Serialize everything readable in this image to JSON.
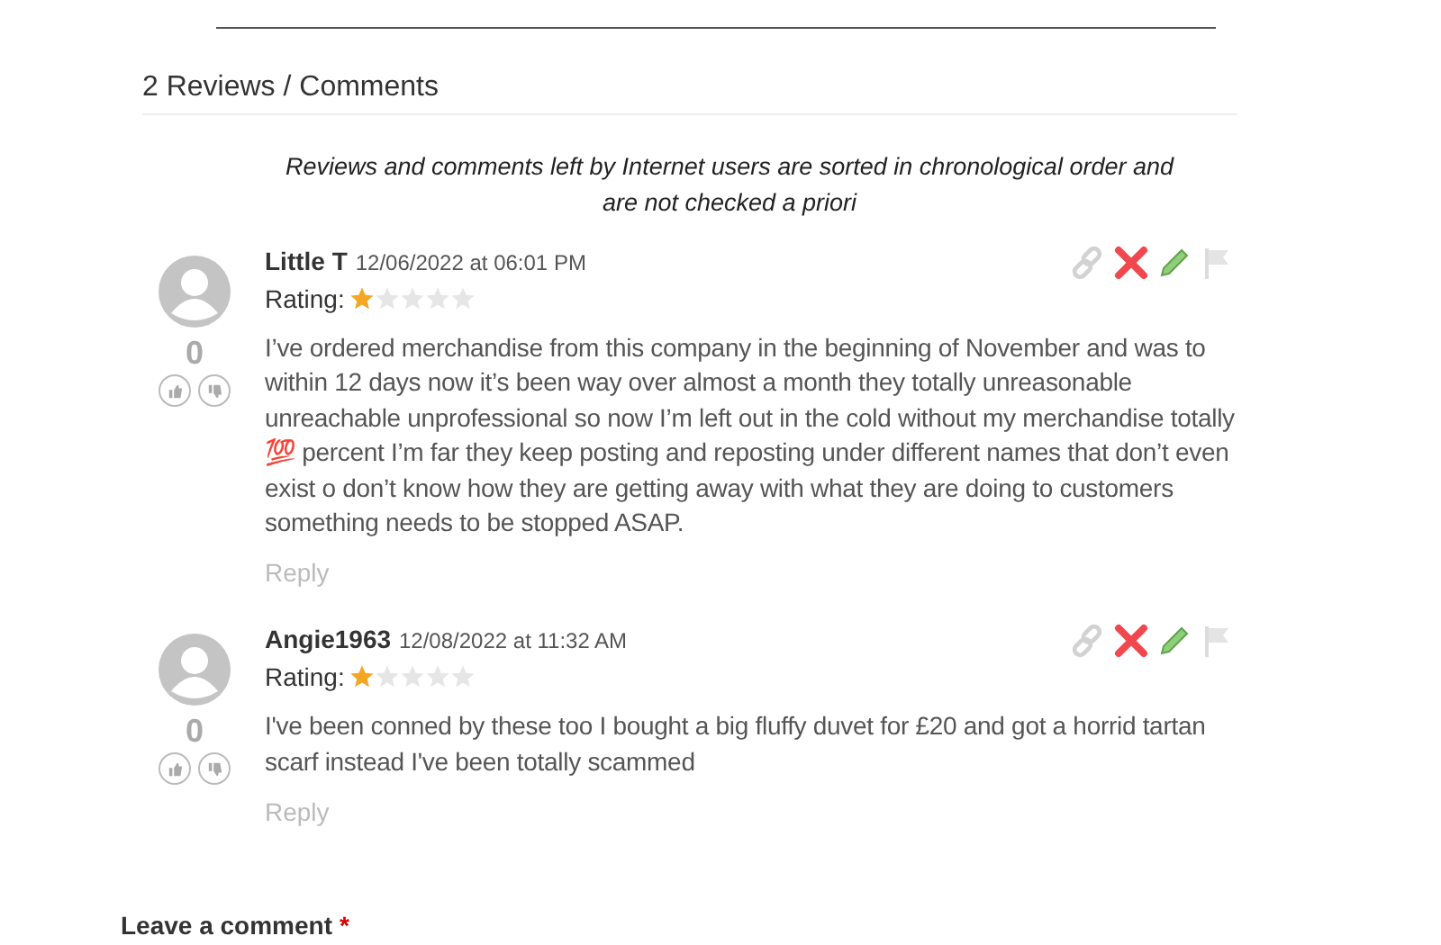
{
  "heading": "2 Reviews / Comments",
  "notice": "Reviews and comments left by Internet users are sorted in chronological order and are not checked a priori",
  "comments": [
    {
      "author": "Little T",
      "date": "12/06/2022 at 06:01 PM",
      "rating_label": "Rating:",
      "stars": 1,
      "votes": "0",
      "text": "I’ve ordered merchandise from this company in the beginning of November and was to within 12 days now it’s been way over almost a month they totally unreasonable unreachable unprofessional so now I’m left out in the cold without my merchandise totally 💯 percent I’m far they keep posting and reposting under different names that don’t even exist o don’t know how they are getting away with what they are doing to customers something needs to be stopped ASAP.",
      "reply": "Reply"
    },
    {
      "author": "Angie1963",
      "date": "12/08/2022 at 11:32 AM",
      "rating_label": "Rating:",
      "stars": 1,
      "votes": "0",
      "text": "I've been conned by these too I bought a big fluffy duvet for £20 and got a horrid tartan scarf instead I've been totally scammed",
      "reply": "Reply"
    }
  ],
  "leave_comment": {
    "label": "Leave a comment",
    "required_mark": "*"
  }
}
